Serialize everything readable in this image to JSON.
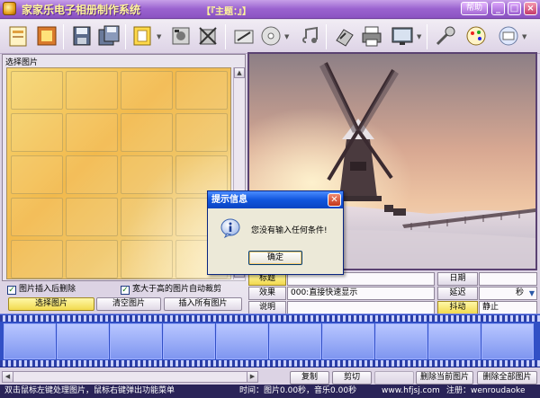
{
  "window": {
    "app_title": "家家乐电子相册制作系统",
    "doc_title": "【『主题：』】",
    "help_label": "帮助",
    "minimize": "_",
    "restore": "□",
    "close": "×"
  },
  "toolbar": {
    "icons": [
      "new-icon",
      "open-album-icon",
      "save-icon",
      "save-as-icon",
      "template-icon",
      "export-icon",
      "delete-icon",
      "edit-icon",
      "cd-icon",
      "music-icon",
      "settings-icon",
      "print-icon",
      "display-icon",
      "tools-icon",
      "paint-icon",
      "mail-icon"
    ]
  },
  "left_panel": {
    "caption": "选择图片",
    "checkbox_delete_after_insert": "图片插入后删除",
    "checkbox_auto_crop": "宽大于高的图片自动裁剪",
    "select_button": "选择图片",
    "clear_button": "清空图片",
    "insert_all_button": "插入所有图片"
  },
  "properties": {
    "title_label": "标题",
    "title_value": "",
    "effect_label": "效果",
    "effect_value": "000:直接快速显示",
    "note_label": "说明",
    "note_value": "",
    "date_label": "日期",
    "date_value": "",
    "delay_label": "延迟",
    "delay_unit": "秒",
    "shake_label": "抖动",
    "shake_value": "静止"
  },
  "bottom_buttons": {
    "copy": "复制",
    "cut": "剪切",
    "delete_current": "删除当前图片",
    "delete_all": "删除全部图片"
  },
  "status": {
    "hint": "双击鼠标左键处理图片，鼠标右键弹出功能菜单",
    "time": "时间：图片0.00秒，音乐0.00秒",
    "site": "www.hfjsj.com",
    "register": "注册：wenroudaoke"
  },
  "dialog": {
    "title": "提示信息",
    "message": "您没有输入任何条件!",
    "ok": "确定"
  },
  "colors": {
    "title_bar": "#9a62cf",
    "filmstrip": "#3150c6",
    "dialog_title": "#1155dd",
    "highlight": "#f2d94e"
  }
}
